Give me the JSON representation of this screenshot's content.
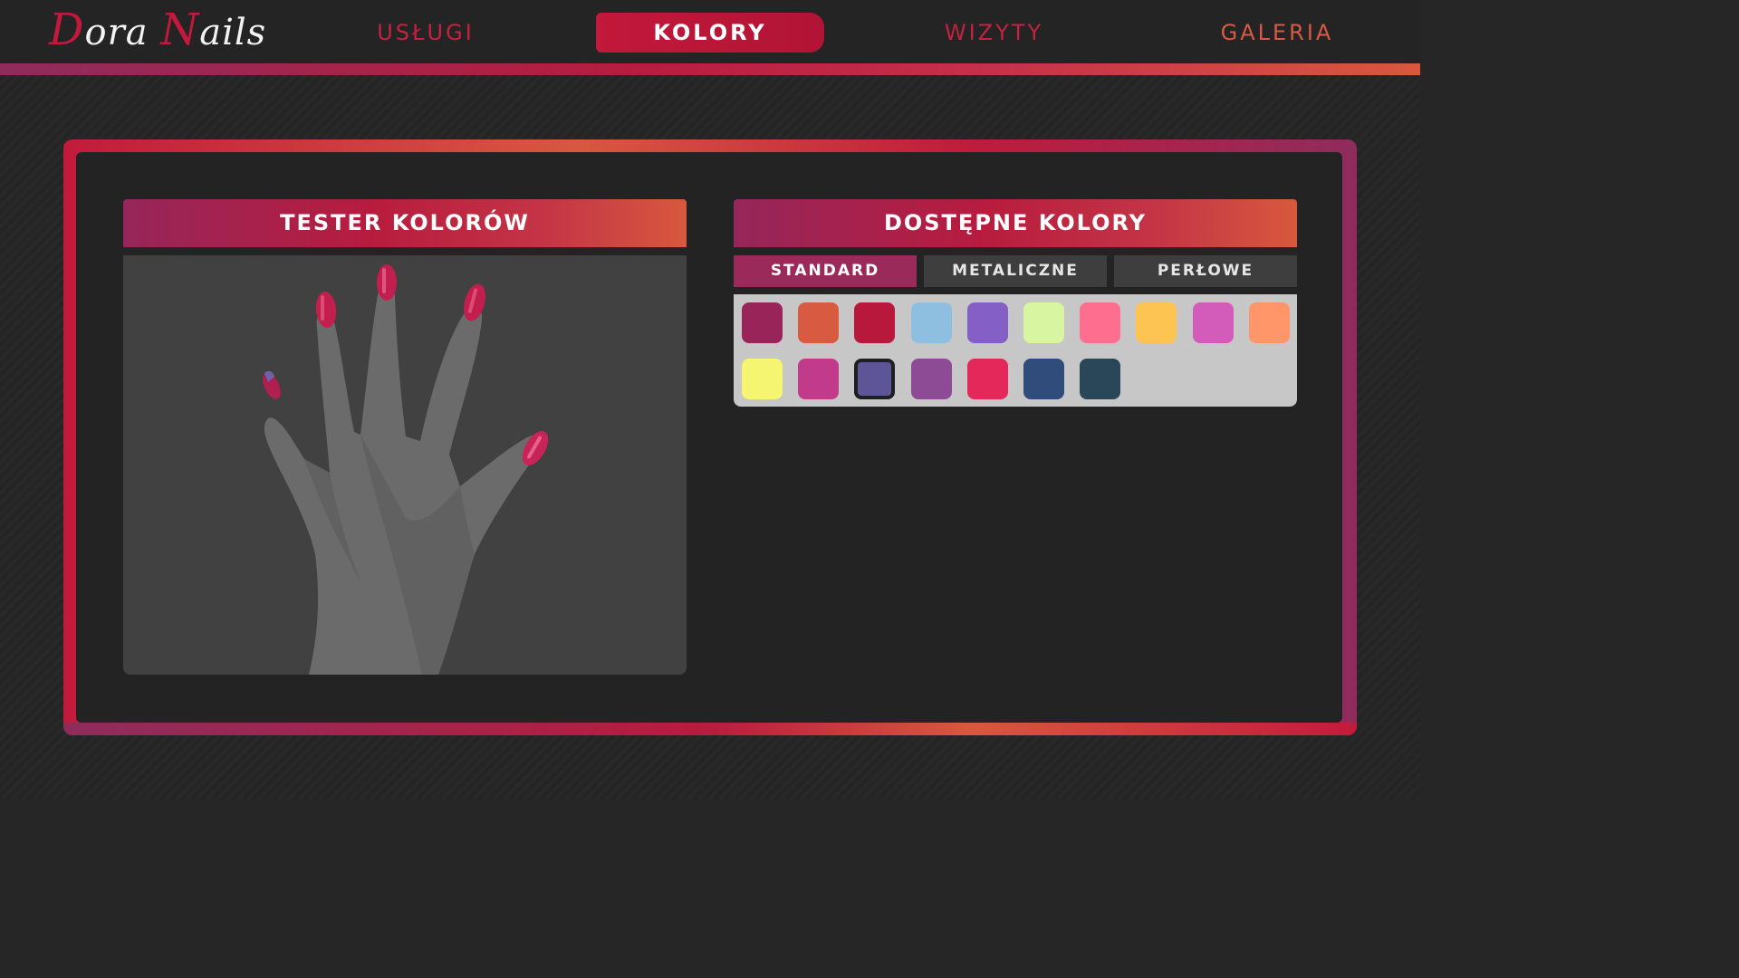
{
  "brand": {
    "logo_part1_cap": "D",
    "logo_part1_rest": "ora ",
    "logo_part2_cap": "N",
    "logo_part2_rest": "ails"
  },
  "nav": {
    "items": [
      {
        "label": "USŁUGI",
        "active": false
      },
      {
        "label": "KOLORY",
        "active": true
      },
      {
        "label": "WIZYTY",
        "active": false
      },
      {
        "label": "GALERIA",
        "active": false
      }
    ]
  },
  "tester": {
    "title": "TESTER KOLORÓW",
    "nail_color": "#c21f4f"
  },
  "colors": {
    "title": "DOSTĘPNE KOLORY",
    "tabs": [
      {
        "label": "STANDARD",
        "active": true
      },
      {
        "label": "METALICZNE",
        "active": false
      },
      {
        "label": "PERŁOWE",
        "active": false
      }
    ],
    "swatches": [
      "#99245a",
      "#d85a40",
      "#b8183c",
      "#8fbfe0",
      "#8460c6",
      "#d8f6a2",
      "#fd6e8f",
      "#fec451",
      "#d35cbb",
      "#fe966a",
      "#f6f572",
      "#c13b8a",
      "#5e5596",
      "#8d4a95",
      "#e4295a",
      "#2f4c7b",
      "#2a4659"
    ],
    "selected_index": 12
  }
}
